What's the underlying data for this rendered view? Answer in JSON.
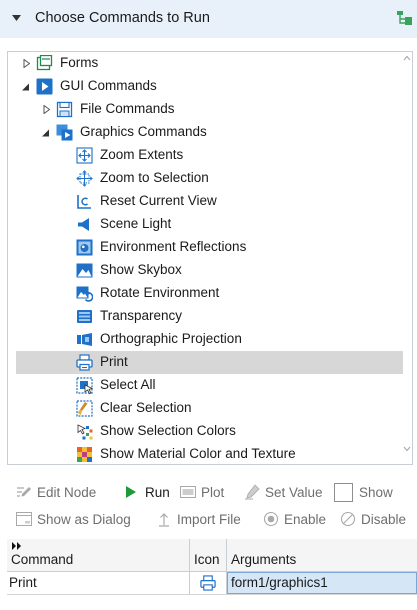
{
  "header": {
    "title": "Choose Commands to Run",
    "expand_icon": "caret-down-icon",
    "settings_icon": "tree-settings-icon"
  },
  "tree": {
    "items": [
      {
        "label": "Forms",
        "level": 0,
        "expander": "collapsed",
        "icon": "forms-icon"
      },
      {
        "label": "GUI Commands",
        "level": 0,
        "expander": "expanded",
        "icon": "gui-commands-icon"
      },
      {
        "label": "File Commands",
        "level": 1,
        "expander": "collapsed",
        "icon": "file-commands-icon"
      },
      {
        "label": "Graphics Commands",
        "level": 1,
        "expander": "expanded",
        "icon": "graphics-commands-icon"
      },
      {
        "label": "Zoom Extents",
        "level": 2,
        "icon": "zoom-extents-icon"
      },
      {
        "label": "Zoom to Selection",
        "level": 2,
        "icon": "zoom-to-selection-icon"
      },
      {
        "label": "Reset Current View",
        "level": 2,
        "icon": "reset-view-icon"
      },
      {
        "label": "Scene Light",
        "level": 2,
        "icon": "scene-light-icon"
      },
      {
        "label": "Environment Reflections",
        "level": 2,
        "icon": "environment-reflections-icon"
      },
      {
        "label": "Show Skybox",
        "level": 2,
        "icon": "skybox-icon"
      },
      {
        "label": "Rotate Environment",
        "level": 2,
        "icon": "rotate-environment-icon"
      },
      {
        "label": "Transparency",
        "level": 2,
        "icon": "transparency-icon"
      },
      {
        "label": "Orthographic Projection",
        "level": 2,
        "icon": "orthographic-projection-icon"
      },
      {
        "label": "Print",
        "level": 2,
        "icon": "print-icon",
        "selected": true
      },
      {
        "label": "Select All",
        "level": 2,
        "icon": "select-all-icon"
      },
      {
        "label": "Clear Selection",
        "level": 2,
        "icon": "clear-selection-icon"
      },
      {
        "label": "Show Selection Colors",
        "level": 2,
        "icon": "selection-colors-icon"
      },
      {
        "label": "Show Material Color and Texture",
        "level": 2,
        "icon": "material-color-icon"
      }
    ]
  },
  "toolbar": {
    "edit_node": "Edit Node",
    "run": "Run",
    "plot": "Plot",
    "set_value": "Set Value",
    "show": "Show",
    "show_as_dialog": "Show as Dialog",
    "import_file": "Import File",
    "enable": "Enable",
    "disable": "Disable"
  },
  "table": {
    "columns": [
      "Command",
      "Icon",
      "Arguments"
    ],
    "rows": [
      {
        "command": "Print",
        "icon": "print-icon",
        "arguments": "form1/graphics1"
      }
    ]
  },
  "colors": {
    "header_bg": "#e8f1fa",
    "selected_row": "#d7d7d7",
    "run_green": "#1f9a3a",
    "accent_blue": "#1e70c8"
  }
}
